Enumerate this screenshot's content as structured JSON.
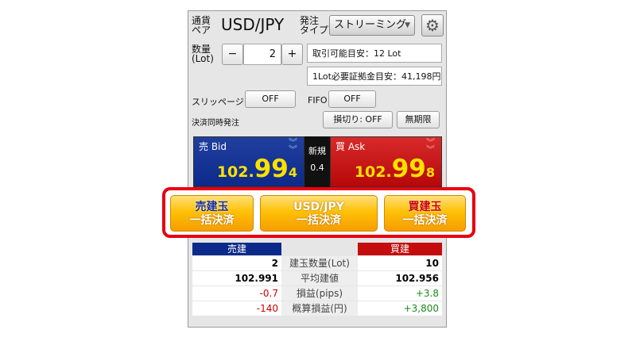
{
  "header": {
    "pair_label": "通貨\nペア",
    "pair_value": "USD/JPY",
    "order_type_label": "発注\nタイプ",
    "order_type_value": "ストリーミング",
    "gear_icon": "gear-icon"
  },
  "quantity": {
    "label": "数量\n(Lot)",
    "minus": "−",
    "value": "2",
    "plus": "+",
    "tradable_estimate": "取引可能目安：12 Lot",
    "margin_estimate": "1Lot必要証拠金目安：41,198円"
  },
  "options": {
    "slippage_label": "スリッページ",
    "slippage_value": "OFF",
    "fifo_label": "FIFO",
    "fifo_value": "OFF",
    "simultaneous_label": "決済同時発注",
    "stop_loss_button": "損切り: OFF",
    "expiry_button": "無期限"
  },
  "quotes": {
    "bid_label": "売 Bid",
    "bid_price_a": "102.",
    "bid_price_b": "99",
    "bid_price_c": "4",
    "spread_label": "新規",
    "spread_value": "0.4",
    "ask_label": "買 Ask",
    "ask_price_a": "102.",
    "ask_price_b": "99",
    "ask_price_c": "8"
  },
  "bulk_buttons": {
    "sell_line1": "売建玉",
    "sell_line2": "一括決済",
    "pair_line1": "USD/JPY",
    "pair_line2": "一括決済",
    "buy_line1": "買建玉",
    "buy_line2": "一括決済"
  },
  "positions": {
    "sell_header": "売建",
    "buy_header": "買建",
    "rows": [
      {
        "label": "建玉数量(Lot)",
        "sell": "2",
        "buy": "10"
      },
      {
        "label": "平均建値",
        "sell": "102.991",
        "buy": "102.956"
      },
      {
        "label": "損益(pips)",
        "sell": "-0.7",
        "buy": "+3.8"
      },
      {
        "label": "概算損益(円)",
        "sell": "-140",
        "buy": "+3,800"
      }
    ]
  },
  "colors": {
    "bid_bg": "#0b2a8a",
    "ask_bg": "#c40d0d",
    "highlight_frame": "#e60012",
    "negative": "#d40000",
    "positive": "#1a8a1a"
  }
}
